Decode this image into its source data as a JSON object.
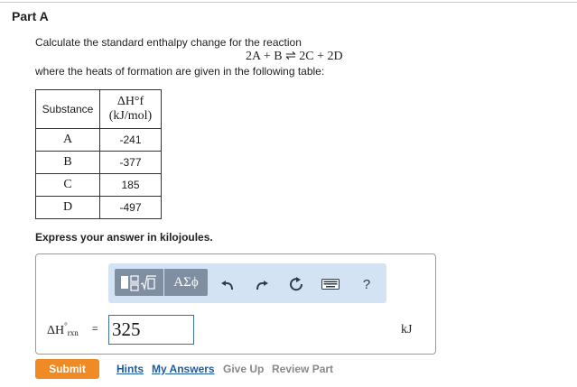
{
  "part": {
    "title": "Part A"
  },
  "question": {
    "prompt": "Calculate the standard enthalpy change for the reaction",
    "equation": "2A + B ⇌ 2C + 2D",
    "followup": "where the heats of formation are given in the following table:"
  },
  "table": {
    "headers": [
      "Substance",
      "ΔH°f",
      "(kJ/mol)"
    ],
    "rows": [
      {
        "substance": "A",
        "value": "-241"
      },
      {
        "substance": "B",
        "value": "-377"
      },
      {
        "substance": "C",
        "value": "185"
      },
      {
        "substance": "D",
        "value": "-497"
      }
    ]
  },
  "instruction": "Express your answer in kilojoules.",
  "toolbar": {
    "greek_label": "ΑΣϕ",
    "icons": [
      "templates-icon",
      "greek-symbols-icon",
      "undo-icon",
      "redo-icon",
      "reset-icon",
      "keyboard-icon",
      "help-icon"
    ],
    "help_label": "?"
  },
  "answer": {
    "label_symbol": "ΔH",
    "label_sup": "°",
    "label_sub": "rxn",
    "equals": "=",
    "value": "325",
    "unit": "kJ"
  },
  "actions": {
    "submit": "Submit",
    "hints": "Hints",
    "my_answers": "My Answers",
    "give_up": "Give Up",
    "review_part": "Review Part"
  },
  "colors": {
    "toolbar_bg": "#d3e3f3",
    "toolbar_button": "#7f8ea0",
    "submit": "#f08a24",
    "link": "#1d5b9e",
    "disabled_link": "#888888"
  }
}
